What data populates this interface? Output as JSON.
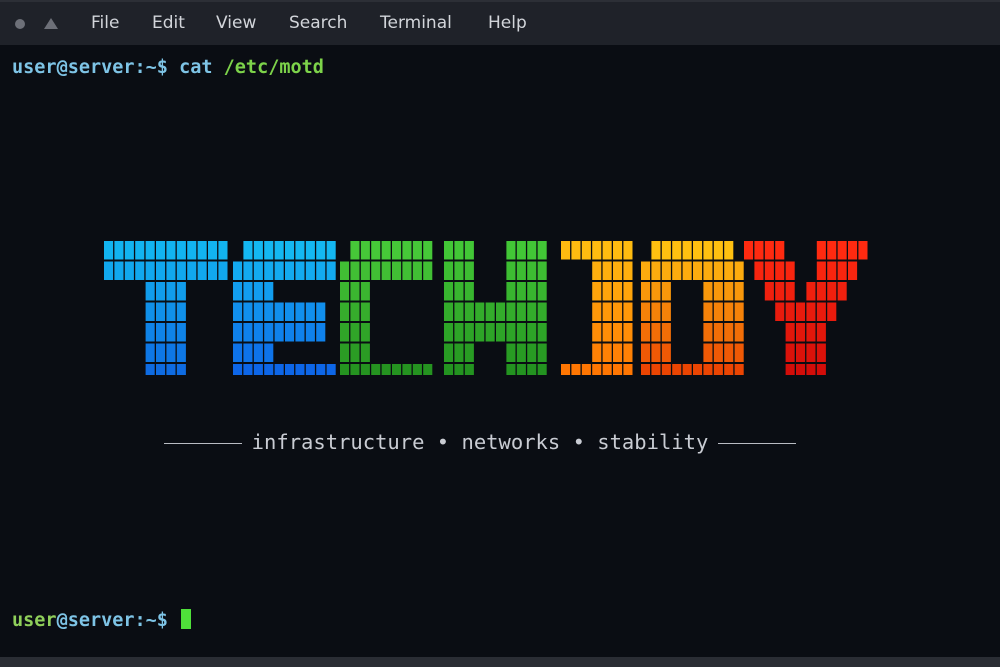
{
  "window": {
    "controls": [
      "close-dot",
      "minimize-triangle"
    ],
    "menu": [
      "File",
      "Edit",
      "View",
      "Search",
      "Terminal",
      "Help"
    ]
  },
  "terminal": {
    "line1": {
      "user": "user",
      "host": "@server:~$",
      "cmd": "cat",
      "arg": "/etc/motd"
    },
    "logo_text": "TECHJOY",
    "tagline": "infrastructure • networks • stability",
    "prompt": {
      "user": "user",
      "host": "@server:~$"
    }
  },
  "colors": {
    "background": "#0a0d13",
    "blue": "#1a8fe8",
    "green": "#3cc030",
    "orange": "#ff9800",
    "red": "#e01010",
    "cursor": "#4fe03a"
  }
}
